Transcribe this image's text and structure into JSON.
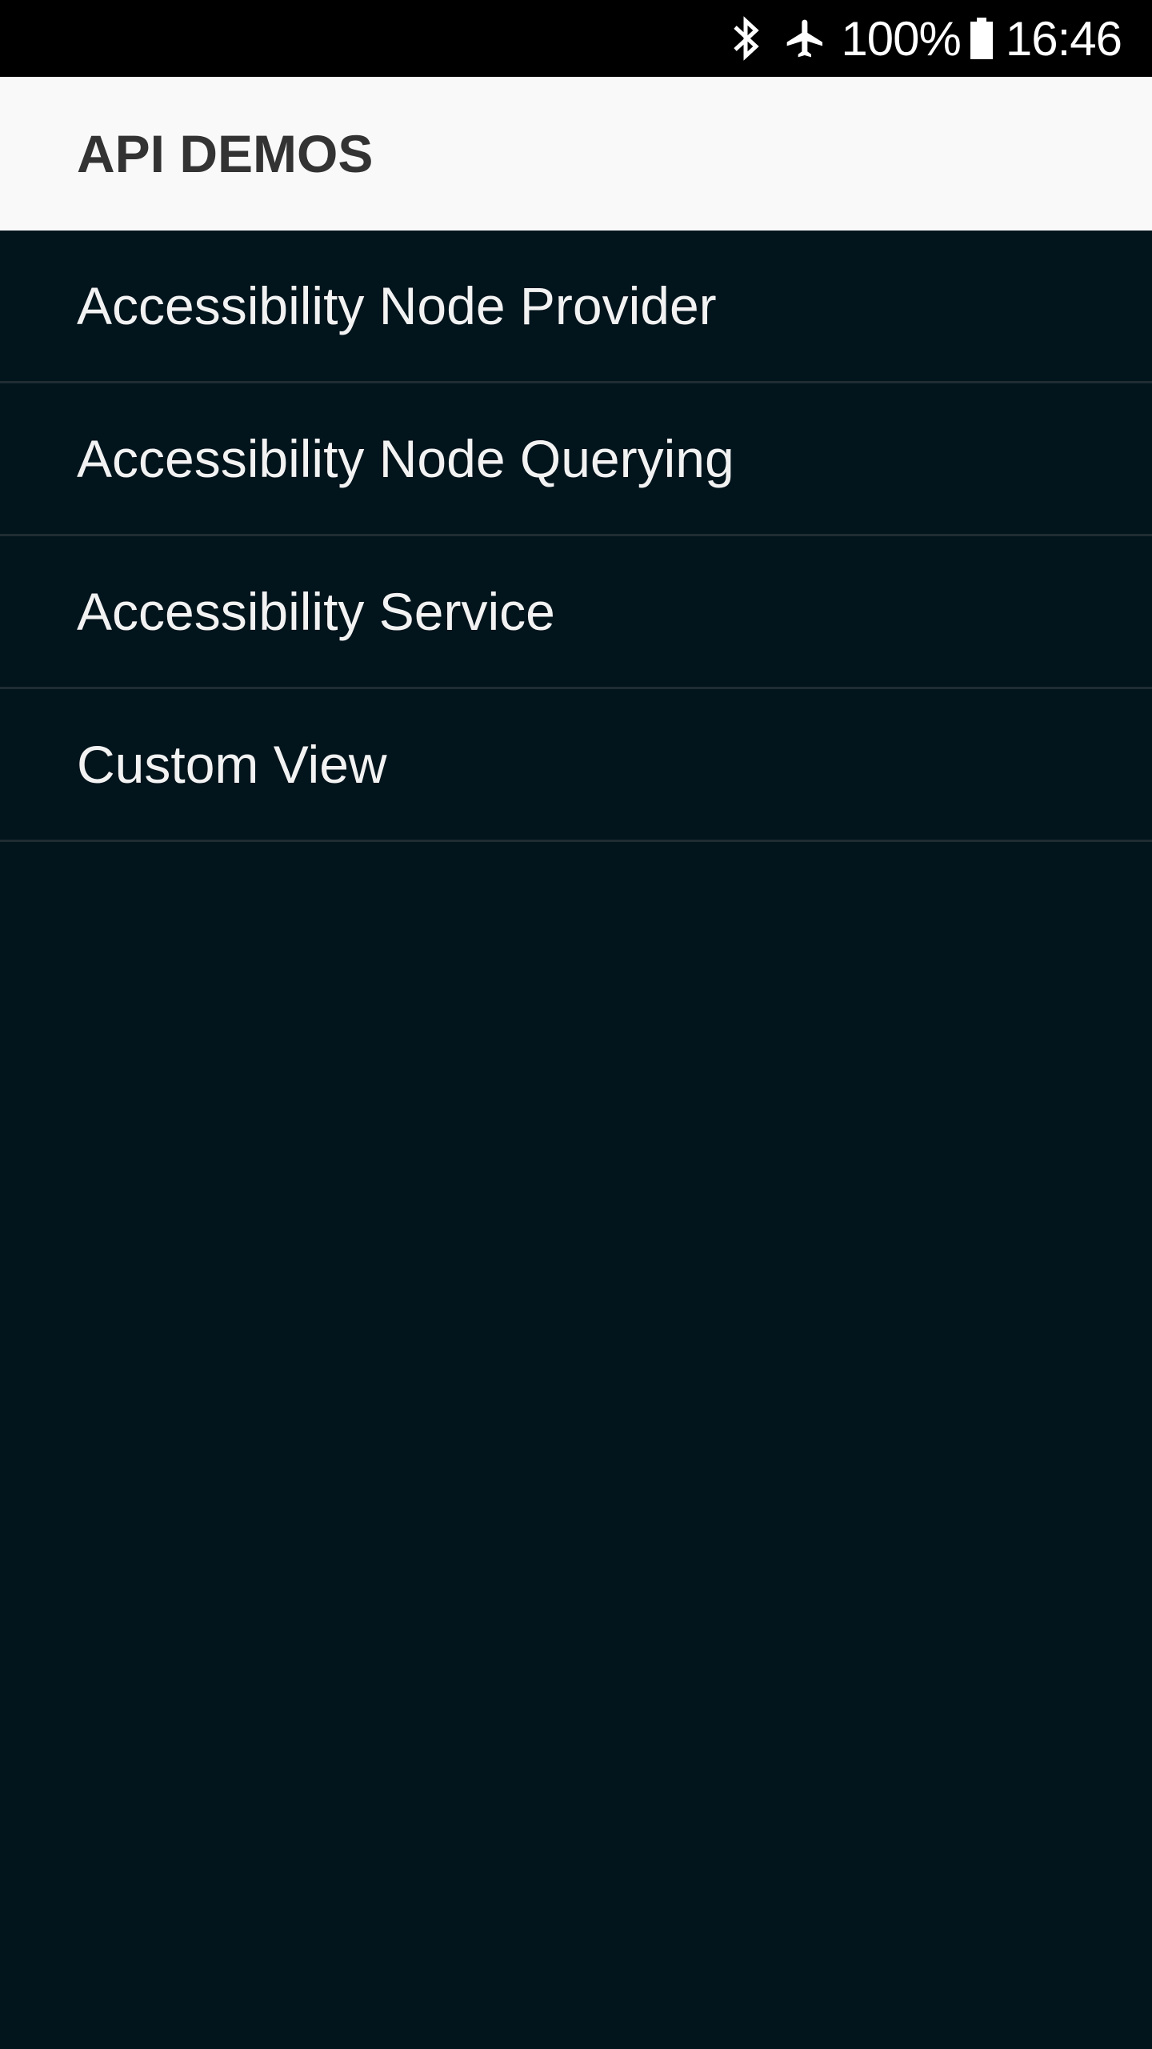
{
  "status_bar": {
    "icons": [
      "bluetooth-icon",
      "airplane-mode-icon",
      "battery-icon"
    ],
    "battery_percent": "100%",
    "time": "16:46"
  },
  "app_bar": {
    "title": "API DEMOS"
  },
  "list": {
    "items": [
      {
        "label": "Accessibility Node Provider"
      },
      {
        "label": "Accessibility Node Querying"
      },
      {
        "label": "Accessibility Service"
      },
      {
        "label": "Custom View"
      }
    ]
  },
  "colors": {
    "status_bar_bg": "#000000",
    "app_bar_bg": "#f9f9f9",
    "title_text": "#333333",
    "list_bg": "#02141c",
    "list_text": "#f2f2f2",
    "divider": "#1f2d33"
  }
}
